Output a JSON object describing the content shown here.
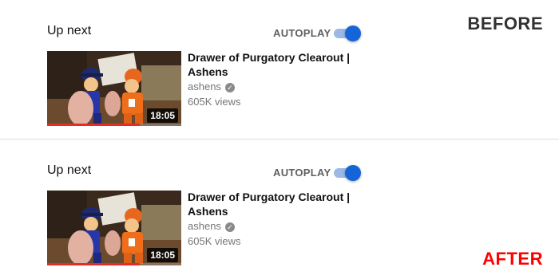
{
  "panels": [
    {
      "tag": "BEFORE",
      "header": {
        "label": "Up next",
        "autoplay_label": "AUTOPLAY",
        "autoplay_on": true
      },
      "video": {
        "title": "Drawer of Purgatory Clearout | Ashens",
        "channel": "ashens",
        "verified": true,
        "views": "605K views",
        "duration": "18:05",
        "watched_fraction": 0.69
      }
    },
    {
      "tag": "AFTER",
      "header": {
        "label": "Up next",
        "autoplay_label": "AUTOPLAY",
        "autoplay_on": true
      },
      "video": {
        "title": "Drawer of Purgatory Clearout | Ashens",
        "channel": "ashens",
        "verified": true,
        "views": "605K views",
        "duration": "18:05",
        "watched_fraction": 0.69
      }
    }
  ],
  "colors": {
    "toggle_knob": "#1565d8",
    "toggle_track": "#9bb8e8",
    "progress": "#e52d27",
    "before_tag": "#333333",
    "after_tag": "#ff0000"
  },
  "icons": {
    "verified": "check-circle-icon"
  }
}
